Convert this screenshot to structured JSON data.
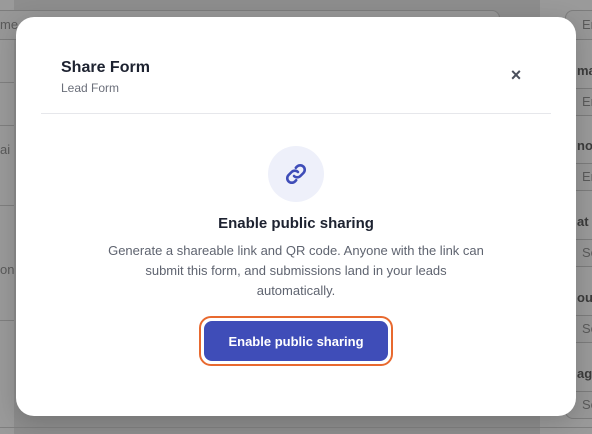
{
  "modal": {
    "title": "Share Form",
    "subtitle": "Lead Form",
    "close_label": "×",
    "heading": "Enable public sharing",
    "description": "Generate a shareable link and QR code. Anyone with the link can submit this form, and submissions land in your leads automatically.",
    "button_label": "Enable public sharing",
    "icon": "link-icon"
  },
  "background": {
    "top_left_fragment": "me",
    "top_right_fragment": "En",
    "left_fragments": [
      "ai",
      "on"
    ],
    "right_labels": [
      "ma",
      "no",
      "at",
      "ou",
      "ag"
    ],
    "right_values": [
      "En",
      "En",
      "Se",
      "Se",
      "Se"
    ]
  },
  "colors": {
    "accent": "#3f4db8",
    "focus_ring": "#e8692f",
    "icon_bg": "#eef0fa"
  }
}
